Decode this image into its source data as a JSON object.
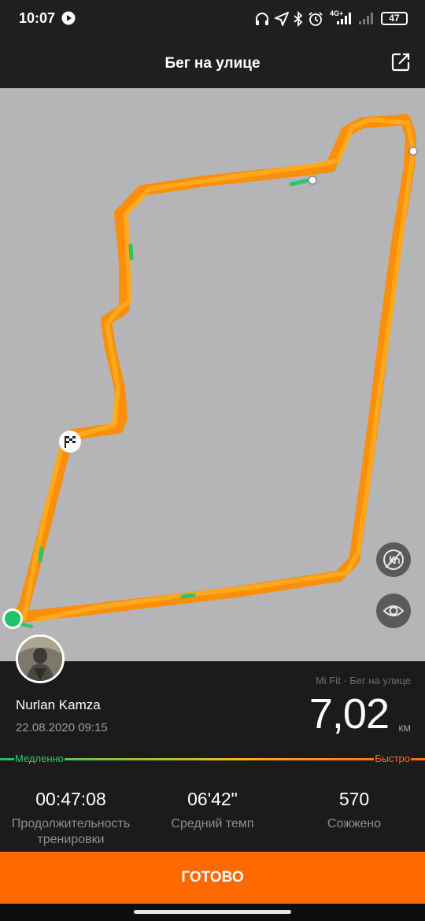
{
  "status_bar": {
    "time": "10:07",
    "network": "4G+",
    "battery": "47",
    "icons": [
      "play-icon",
      "headphones-icon",
      "location-arrow-icon",
      "bluetooth-icon",
      "alarm-icon",
      "signal-icon",
      "signal-weak-icon",
      "battery-icon"
    ]
  },
  "header": {
    "title": "Бег на улице",
    "share_icon": "share-icon"
  },
  "map": {
    "controls": [
      "km-markers-toggle-icon",
      "eye-icon"
    ],
    "markers": [
      "start-marker",
      "finish-flag-icon"
    ],
    "route_colors": {
      "fast": "#ff8a00",
      "slow": "#2bc56c"
    }
  },
  "workout": {
    "user_name": "Nurlan Kamza",
    "date": "22.08.2020 09:15",
    "source": "Mi Fit · Бег на улице",
    "distance": "7,02",
    "distance_unit": "км"
  },
  "pace_scale": {
    "slow_label": "Медленно",
    "fast_label": "Быстро",
    "slow_color": "#2fca73",
    "fast_color": "#ff6d1f"
  },
  "stats": [
    {
      "value": "00:47:08",
      "label": "Продолжительность тренировки"
    },
    {
      "value": "06'42\"",
      "label": "Средний темп"
    },
    {
      "value": "570",
      "label": "Сожжено"
    }
  ],
  "actions": {
    "done_label": "ГОТОВО"
  },
  "colors": {
    "accent": "#ff6a00",
    "map_bg": "#b5b5b7",
    "panel_bg": "#1b1b1b"
  }
}
